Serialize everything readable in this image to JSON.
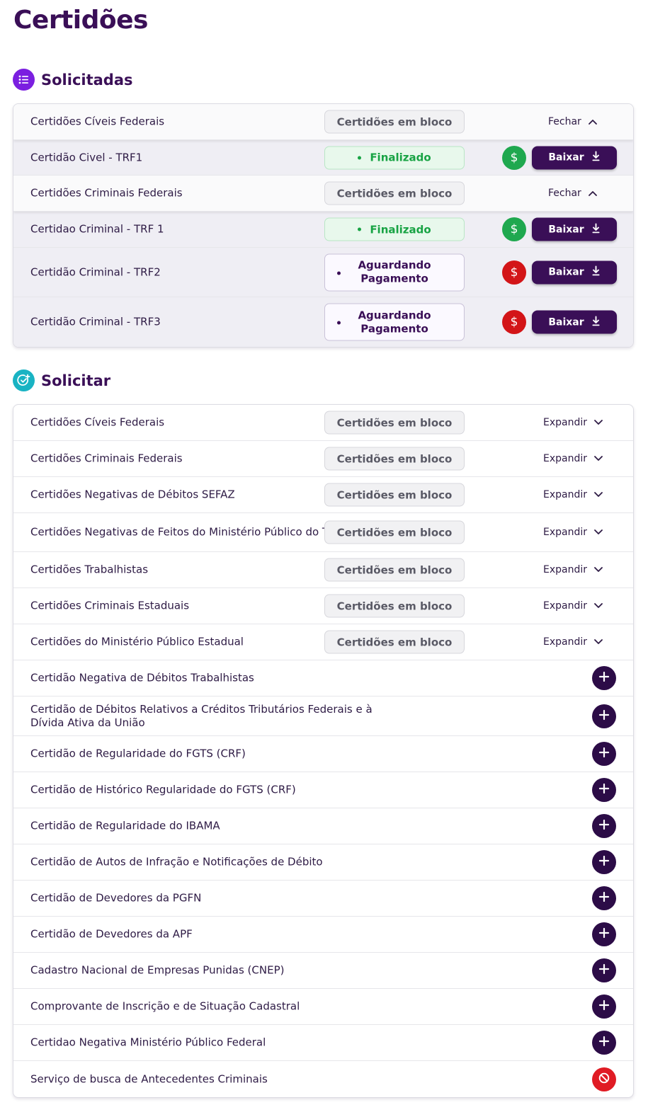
{
  "page_title": "Certidões",
  "solicitadas": {
    "title": "Solicitadas",
    "rows": [
      {
        "kind": "group",
        "name": "Certidões Cíveis Federais",
        "pill": "Certidões em bloco",
        "toggle": "Fechar"
      },
      {
        "kind": "item",
        "name": "Certidão Civel - TRF1",
        "status": "Finalizado",
        "paid": true,
        "action": "Baixar"
      },
      {
        "kind": "group",
        "name": "Certidões Criminais Federais",
        "pill": "Certidões em bloco",
        "toggle": "Fechar"
      },
      {
        "kind": "item",
        "name": "Certidao Criminal - TRF 1",
        "status": "Finalizado",
        "paid": true,
        "action": "Baixar"
      },
      {
        "kind": "item",
        "name": "Certidão Criminal - TRF2",
        "status_line1": "Aguardando",
        "status_line2": "Pagamento",
        "paid": false,
        "action": "Baixar"
      },
      {
        "kind": "item",
        "name": "Certidão Criminal - TRF3",
        "status_line1": "Aguardando",
        "status_line2": "Pagamento",
        "paid": false,
        "action": "Baixar"
      }
    ]
  },
  "solicitar": {
    "title": "Solicitar",
    "groups": [
      {
        "name": "Certidões Cíveis Federais",
        "pill": "Certidões em bloco",
        "toggle": "Expandir"
      },
      {
        "name": "Certidões Criminais Federais",
        "pill": "Certidões em bloco",
        "toggle": "Expandir"
      },
      {
        "name": "Certidões Negativas de Débitos SEFAZ",
        "pill": "Certidões em bloco",
        "toggle": "Expandir"
      },
      {
        "name": "Certidões Negativas de Feitos do Ministério Público do Trabalho",
        "pill": "Certidões em bloco",
        "toggle": "Expandir"
      },
      {
        "name": "Certidões Trabalhistas",
        "pill": "Certidões em bloco",
        "toggle": "Expandir"
      },
      {
        "name": "Certidões Criminais Estaduais",
        "pill": "Certidões em bloco",
        "toggle": "Expandir"
      },
      {
        "name": "Certidões do Ministério Público Estadual",
        "pill": "Certidões em bloco",
        "toggle": "Expandir"
      }
    ],
    "items": [
      {
        "name": "Certidão Negativa de Débitos Trabalhistas",
        "available": true
      },
      {
        "name": "Certidão de Débitos Relativos a Créditos Tributários Federais e à Dívida Ativa da União",
        "available": true
      },
      {
        "name": "Certidão de Regularidade do FGTS (CRF)",
        "available": true
      },
      {
        "name": "Certidão de Histórico Regularidade do FGTS (CRF)",
        "available": true
      },
      {
        "name": "Certidão de Regularidade do IBAMA",
        "available": true
      },
      {
        "name": "Certidão de Autos de Infração e Notificações de Débito",
        "available": true
      },
      {
        "name": "Certidão de Devedores da PGFN",
        "available": true
      },
      {
        "name": "Certidão de Devedores da APF",
        "available": true
      },
      {
        "name": "Cadastro Nacional de Empresas Punidas (CNEP)",
        "available": true
      },
      {
        "name": "Comprovante de Inscrição e de Situação Cadastral",
        "available": true
      },
      {
        "name": "Certidao Negativa Ministério Público Federal",
        "available": true
      },
      {
        "name": "Serviço de busca de Antecedentes Criminais",
        "available": false
      }
    ]
  },
  "icons": {
    "solicitadas": "list-icon",
    "solicitar": "check-plus-icon",
    "paid": "dollar-icon",
    "download": "download-icon",
    "add": "plus-icon",
    "blocked": "prohibited-icon",
    "fechar": "chevron-up-icon",
    "expandir": "chevron-down-icon"
  },
  "colors": {
    "primary": "#3a0f57",
    "success": "#1fa84f",
    "danger": "#d31518",
    "accent_purple": "#7b1fe0",
    "accent_teal": "#19b3c3"
  }
}
